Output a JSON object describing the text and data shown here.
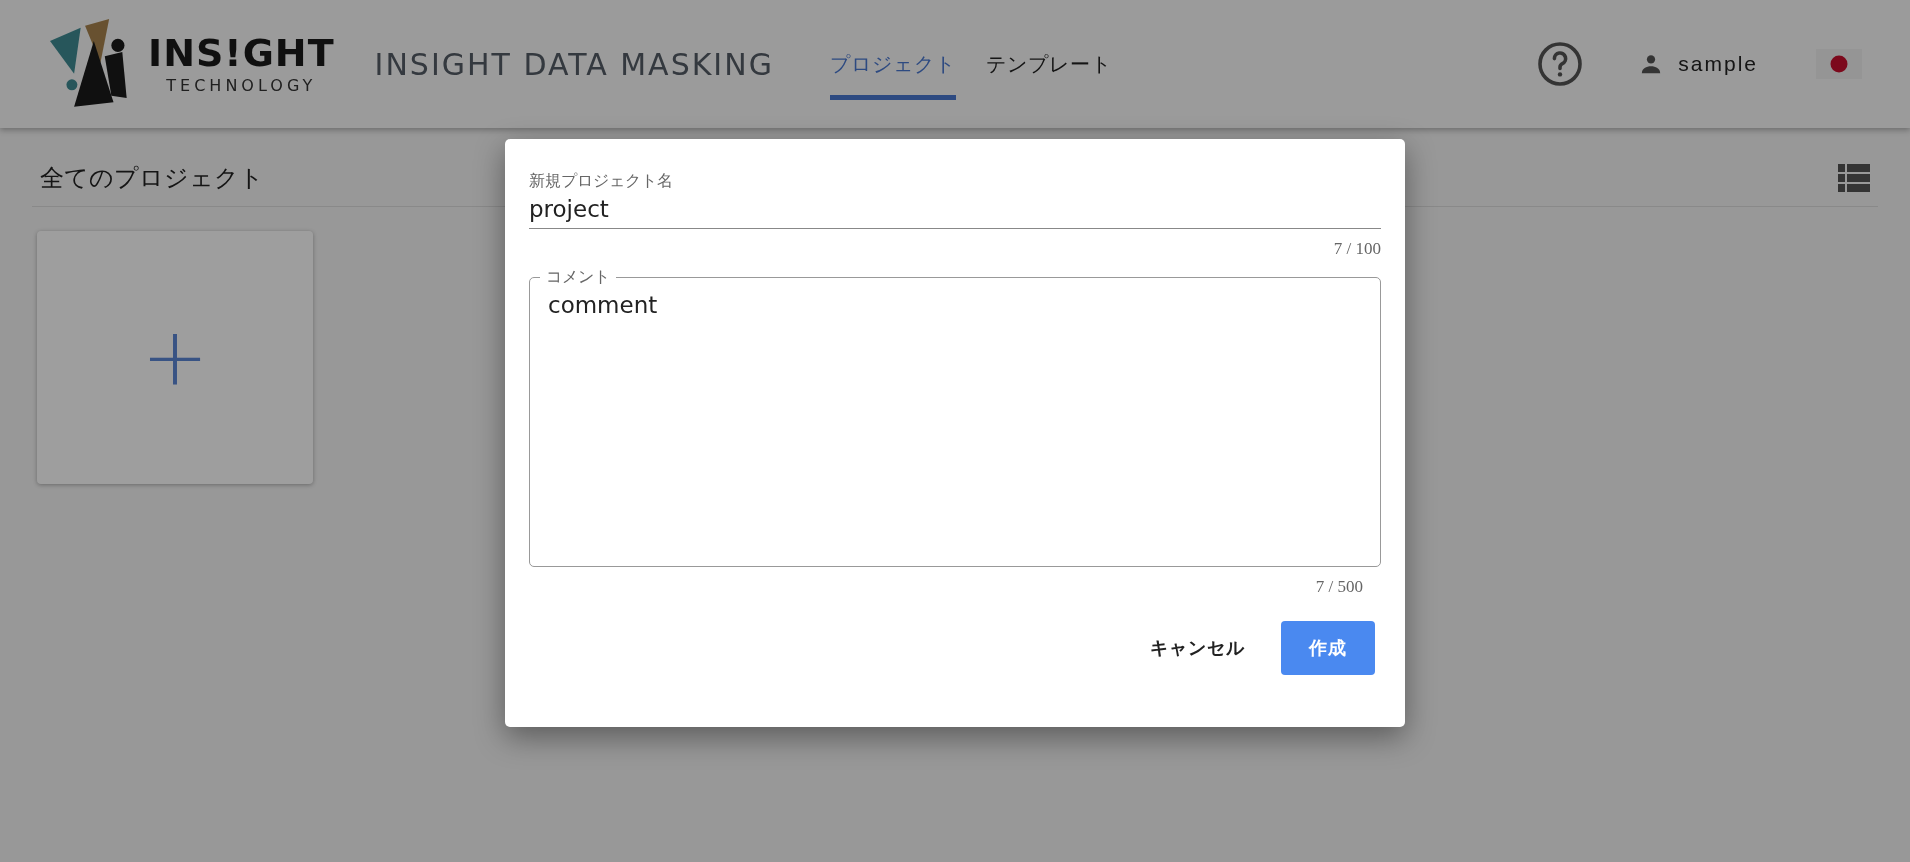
{
  "header": {
    "logo": {
      "name": "INS!GHT",
      "subtitle": "TECHNOLOGY"
    },
    "app_title": "INSIGHT DATA MASKING",
    "tabs": [
      {
        "label": "プロジェクト",
        "selected": true
      },
      {
        "label": "テンプレート",
        "selected": false
      }
    ],
    "user": "sample"
  },
  "page": {
    "title": "全てのプロジェクト",
    "add_card": {
      "label": "+"
    }
  },
  "dialog": {
    "name_field": {
      "label": "新規プロジェクト名",
      "value": "project",
      "counter": "7 / 100"
    },
    "comment_field": {
      "label": "コメント",
      "value": "comment",
      "counter": "7 / 500"
    },
    "buttons": [
      {
        "label": "キャンセル",
        "kind": "text"
      },
      {
        "label": "作成",
        "kind": "primary"
      }
    ]
  }
}
